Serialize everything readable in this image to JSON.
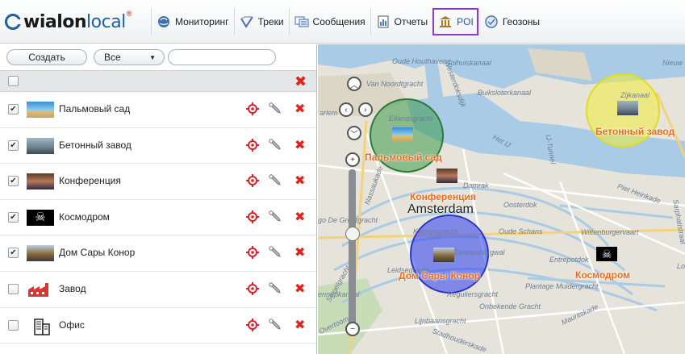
{
  "app": {
    "logo_text_bold": "wialon",
    "logo_text_light": "local",
    "logo_sup": "®"
  },
  "tabs": [
    {
      "label": "Мониторинг",
      "icon": "globe-icon"
    },
    {
      "label": "Треки",
      "icon": "track-icon"
    },
    {
      "label": "Сообщения",
      "icon": "messages-icon"
    },
    {
      "label": "Отчеты",
      "icon": "reports-icon"
    },
    {
      "label": "POI",
      "icon": "landmark-icon",
      "active": true
    },
    {
      "label": "Геозоны",
      "icon": "geofence-icon"
    }
  ],
  "controls": {
    "create_label": "Создать",
    "filter_value": "Все",
    "search_placeholder": ""
  },
  "poi_list": [
    {
      "name": "Пальмовый сад",
      "checked": true,
      "icon": "palm-photo-icon"
    },
    {
      "name": "Бетонный завод",
      "checked": true,
      "icon": "factory-photo-icon"
    },
    {
      "name": "Конференция",
      "checked": true,
      "icon": "conference-photo-icon"
    },
    {
      "name": "Космодром",
      "checked": true,
      "icon": "pirate-flag-icon"
    },
    {
      "name": "Дом Сары Конор",
      "checked": true,
      "icon": "house-photo-icon"
    },
    {
      "name": "Завод",
      "checked": false,
      "icon": "factory-icon"
    },
    {
      "name": "Офис",
      "checked": false,
      "icon": "office-icon"
    }
  ],
  "map": {
    "city_label": "Amsterdam",
    "street_labels": [
      "Oude Houthaven",
      "Tolhuiskanaal",
      "Nieuw",
      "Van Noordtgracht",
      "Westerdoksdijk",
      "Buiksloterkanaal",
      "Zijkanaal",
      "arlem",
      "Ellandsgracht",
      "Het IJ",
      "IJ-Tunnel",
      "Damrak",
      "Piet Heinkade",
      "Oosterdok",
      "go De Grootgracht",
      "Nassaukade",
      "Kaizersgracht",
      "Oude Schans",
      "Wittenburgervaart",
      "Entrepotdok",
      "Zwanenburgwal",
      "Leidsegracht",
      "Plantage Muidergracht",
      "Reguliersgracht",
      "Onbekende Gracht",
      "Lijnbaansgracht",
      "Singelgracht",
      "Mauritskade",
      "Sarphatistraat",
      "Overtoom",
      "Stadhouderskade",
      "ennepkanaal",
      "Lo"
    ],
    "poi_labels": {
      "palm": "Пальмовый сад",
      "factory": "Бетонный завод",
      "conference": "Конференция",
      "cosmodrome": "Космодром",
      "house": "Дом Сары Конор"
    }
  },
  "colors": {
    "accent": "#8a3ec4",
    "brand_blue": "#1f5fa8",
    "delete_red": "#e2211b",
    "poi_label": "#ef6a1b",
    "circle_green": "#3d9a4c",
    "circle_yellow": "#f2ef3a",
    "circle_blue": "#3a4af0"
  }
}
